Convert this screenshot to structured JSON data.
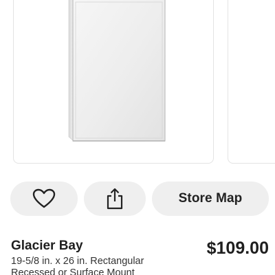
{
  "product": {
    "brand": "Glacier Bay",
    "price": "$109.00",
    "description_lines": [
      "19-5/8 in. x 26 in. Rectangular",
      "Recessed or Surface Mount"
    ],
    "image_subject": "medicine-cabinet-mirror-image"
  },
  "actions": {
    "favorite_icon": "heart-icon",
    "share_icon": "share-icon",
    "store_map_label": "Store Map"
  },
  "colors": {
    "button_bg": "#efefef",
    "text": "#1f1f1f",
    "card_border": "#e3e3e3"
  }
}
